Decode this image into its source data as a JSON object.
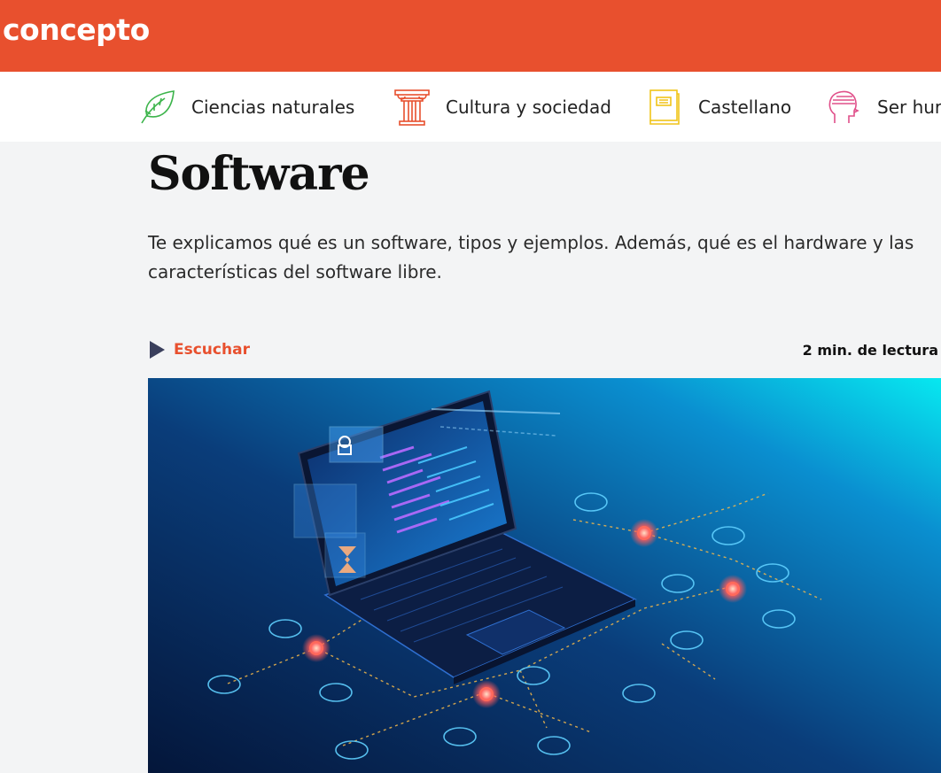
{
  "header": {
    "logo_text": "concepto",
    "brand_color": "#e8502e"
  },
  "categories": [
    {
      "label": "Ciencias naturales",
      "icon": "leaf-icon",
      "color": "#3cb44b"
    },
    {
      "label": "Cultura y sociedad",
      "icon": "column-icon",
      "color": "#e8502e"
    },
    {
      "label": "Castellano",
      "icon": "book-icon",
      "color": "#f0c419"
    },
    {
      "label": "Ser hur",
      "icon": "human-head-icon",
      "color": "#e0508a"
    }
  ],
  "article": {
    "title": "Software",
    "subtitle": "Te explicamos qué es un software, tipos y ejemplos. Además, qué es el hardware y las características del software libre.",
    "listen_label": "Escuchar",
    "reading_time": "2 min. de lectura",
    "hero_image": "laptop-software-illustration"
  }
}
